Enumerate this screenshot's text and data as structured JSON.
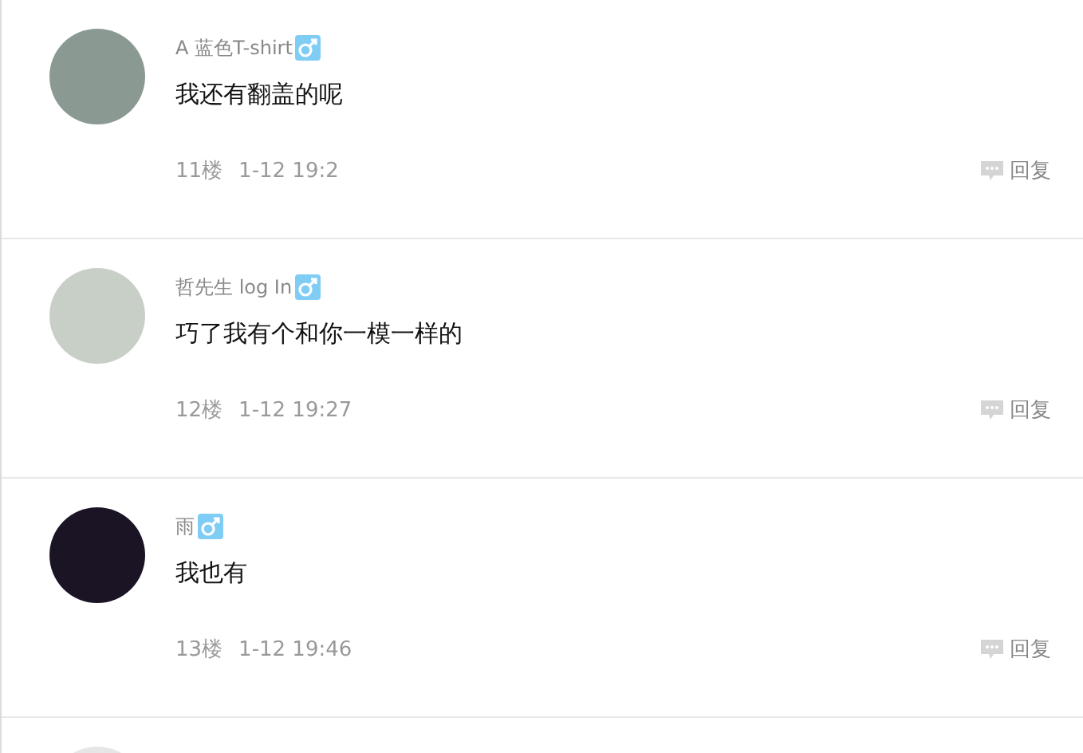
{
  "comments": [
    {
      "author": "A 蓝色T-shirt",
      "text": "我还有翻盖的呢",
      "floor": "11楼",
      "time": "1-12 19:2",
      "reply": "回复"
    },
    {
      "author": "哲先生 log In",
      "text": "巧了我有个和你一模一样的",
      "floor": "12楼",
      "time": "1-12 19:27",
      "reply": "回复"
    },
    {
      "author": "雨",
      "text": "我也有",
      "floor": "13楼",
      "time": "1-12 19:46",
      "reply": "回复"
    }
  ]
}
